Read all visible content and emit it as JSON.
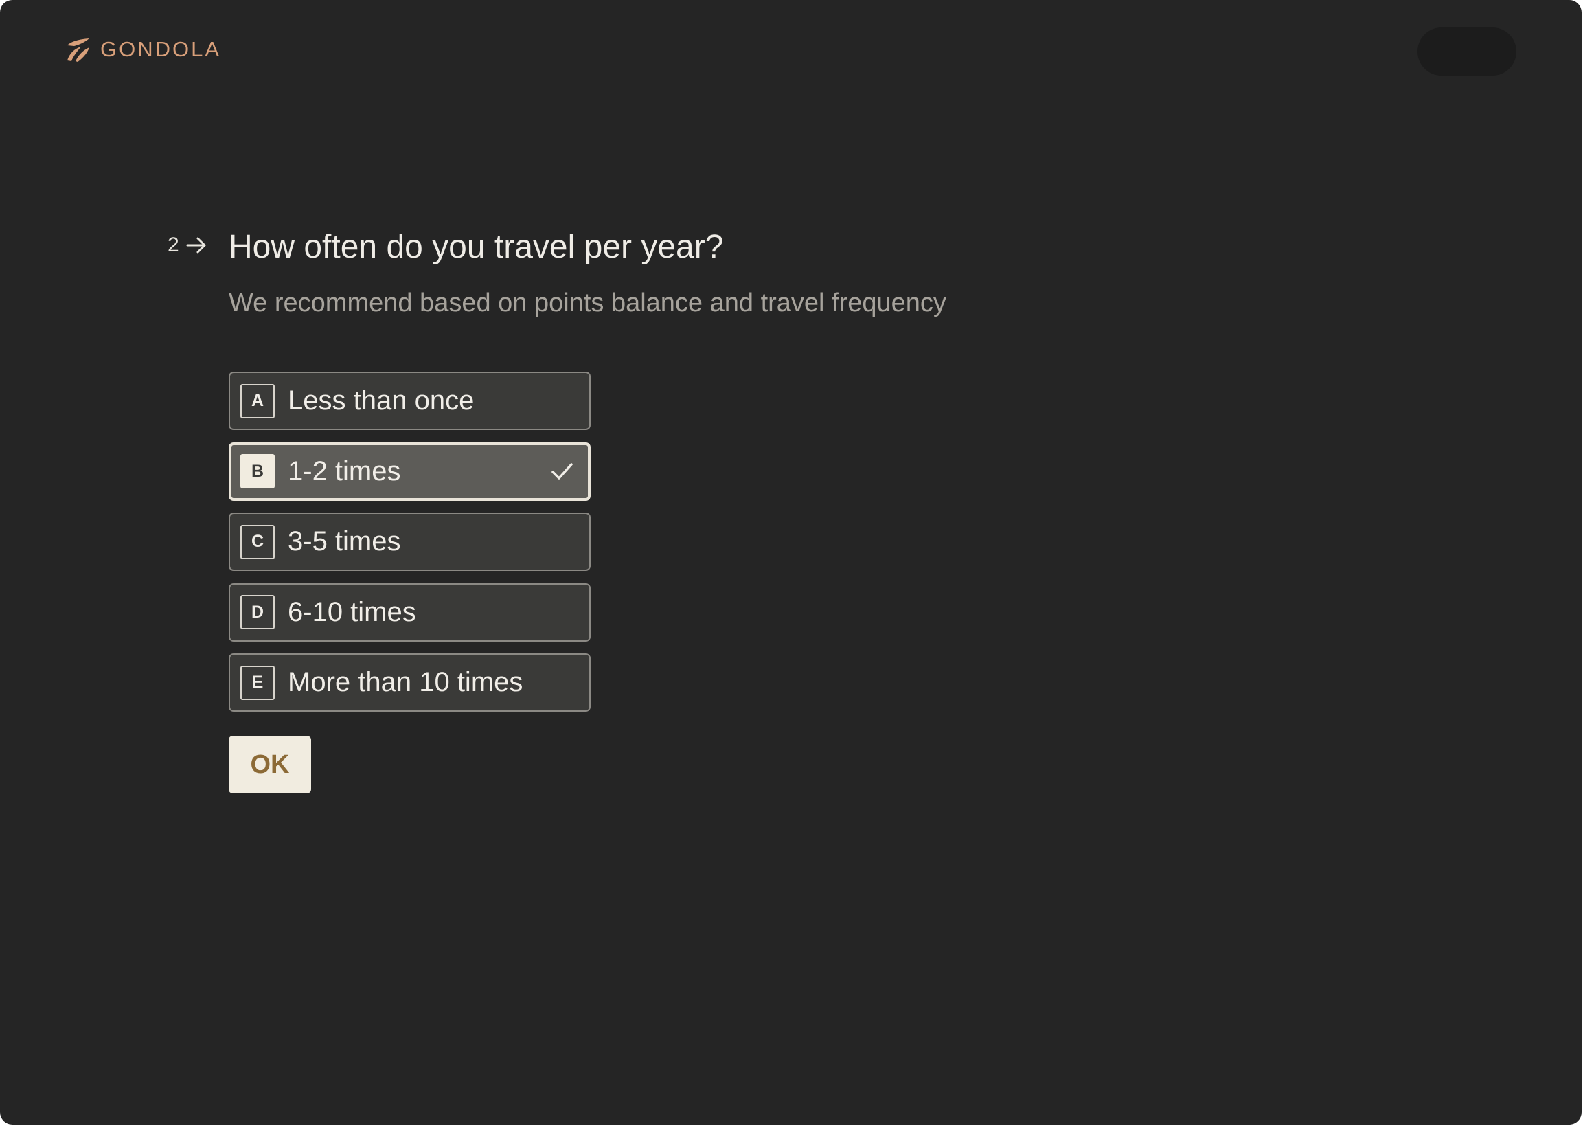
{
  "brand": {
    "name": "GONDOLA",
    "icon": "gondola-logo-icon",
    "color": "#d9a07a"
  },
  "question": {
    "number": "2",
    "arrow_icon": "arrow-right-icon",
    "title": "How often do you travel per year?",
    "subtitle": "We recommend based on points balance and travel frequency"
  },
  "options": [
    {
      "key": "A",
      "label": "Less than once",
      "selected": false
    },
    {
      "key": "B",
      "label": "1-2 times",
      "selected": true
    },
    {
      "key": "C",
      "label": "3-5 times",
      "selected": false
    },
    {
      "key": "D",
      "label": "6-10 times",
      "selected": false
    },
    {
      "key": "E",
      "label": "More than 10 times",
      "selected": false
    }
  ],
  "submit": {
    "label": "OK"
  },
  "colors": {
    "background": "#252525",
    "option_background": "#3a3a38",
    "selected_background": "#5d5c58",
    "button_background": "#f1ece0",
    "button_text": "#8c6a36"
  }
}
